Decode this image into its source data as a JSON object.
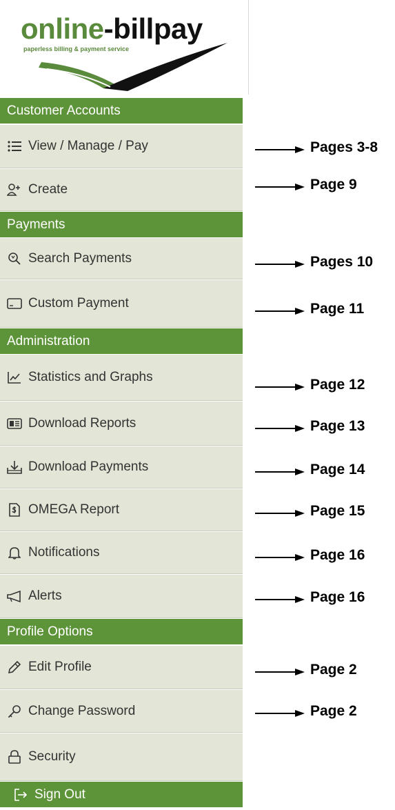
{
  "logo": {
    "word1": "online",
    "word2": "-billpay",
    "tagline": "paperless billing & payment service"
  },
  "sections": {
    "customer_accounts": "Customer Accounts",
    "payments": "Payments",
    "administration": "Administration",
    "profile_options": "Profile Options"
  },
  "menu": {
    "view_manage_pay": "View / Manage / Pay",
    "create": "Create",
    "search_payments": "Search Payments",
    "custom_payment": "Custom Payment",
    "statistics_graphs": "Statistics and Graphs",
    "download_reports": "Download Reports",
    "download_payments": "Download Payments",
    "omega_report": "OMEGA Report",
    "notifications": "Notifications",
    "alerts": "Alerts",
    "edit_profile": "Edit Profile",
    "change_password": "Change Password",
    "security": "Security",
    "sign_out": "Sign Out"
  },
  "annotations": {
    "view_manage_pay": "Pages 3-8",
    "create": "Page 9",
    "search_payments": "Pages 10",
    "custom_payment": "Page 11",
    "statistics_graphs": "Page 12",
    "download_reports": "Page 13",
    "download_payments": "Page 14",
    "omega_report": "Page 15",
    "notifications": "Page 16",
    "alerts": "Page 16",
    "edit_profile": "Page 2",
    "change_password": "Page 2"
  },
  "colors": {
    "section_green": "#5e9439",
    "item_bg": "#e3e6d6",
    "logo_green": "#5a8a3c"
  }
}
